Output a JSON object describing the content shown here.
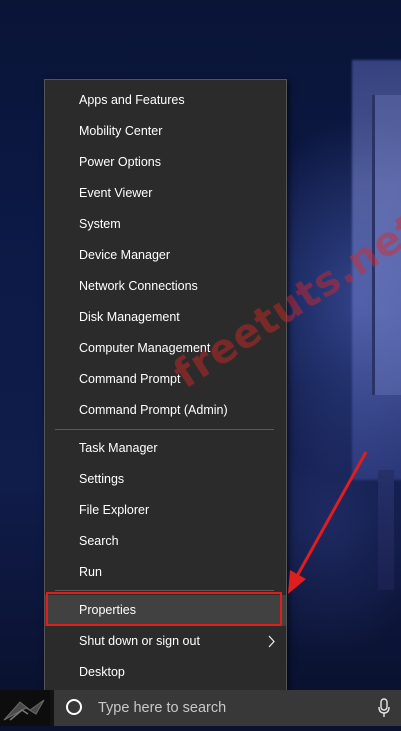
{
  "context_menu": {
    "group1": [
      {
        "label": "Apps and Features"
      },
      {
        "label": "Mobility Center"
      },
      {
        "label": "Power Options"
      },
      {
        "label": "Event Viewer"
      },
      {
        "label": "System"
      },
      {
        "label": "Device Manager"
      },
      {
        "label": "Network Connections"
      },
      {
        "label": "Disk Management"
      },
      {
        "label": "Computer Management"
      },
      {
        "label": "Command Prompt"
      },
      {
        "label": "Command Prompt (Admin)"
      }
    ],
    "group2": [
      {
        "label": "Task Manager"
      },
      {
        "label": "Settings"
      },
      {
        "label": "File Explorer"
      },
      {
        "label": "Search"
      },
      {
        "label": "Run"
      }
    ],
    "group3": [
      {
        "label": "Properties",
        "highlighted": true
      },
      {
        "label": "Shut down or sign out",
        "has_submenu": true
      },
      {
        "label": "Desktop"
      }
    ]
  },
  "watermark": {
    "text": "freetuts.net"
  },
  "taskbar": {
    "search_placeholder": "Type here to search",
    "icons": [
      "rog-logo-icon",
      "cortana-circle-icon",
      "microphone-icon"
    ]
  },
  "colors": {
    "menu_bg": "#2b2b2b",
    "menu_text": "#ffffff",
    "highlight_border": "#e01e1e",
    "annotation_arrow": "#e01e1e"
  }
}
